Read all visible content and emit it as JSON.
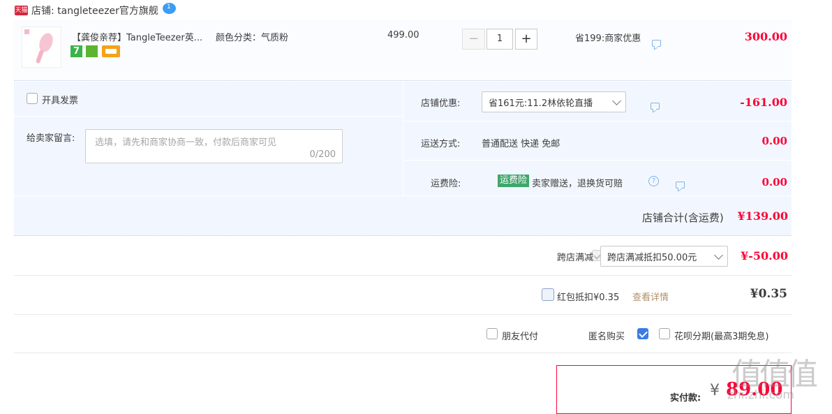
{
  "shop": {
    "badge": "天猫",
    "name": "店铺: tangleteezer官方旗舰",
    "wangwang_badge": "1"
  },
  "item": {
    "title": "【龚俊亲荐】TangleTeezer英...",
    "variant": "颜色分类：气质粉",
    "price": "499.00",
    "quantity": "1",
    "minus": "−",
    "plus": "+",
    "discount": "省199:商家优惠",
    "subtotal": "300.00",
    "badge_seven": "7",
    "image_icon": "pink-hairbrush"
  },
  "invoice": {
    "label": "开具发票"
  },
  "note": {
    "label": "给卖家留言:",
    "placeholder": "选填，请先和商家协商一致，付款后商家可见",
    "counter": "0/200"
  },
  "shop_discount": {
    "label": "店铺优惠:",
    "selected": "省161元:11.2林依轮直播",
    "amount": "-161.00"
  },
  "shipping": {
    "label": "运送方式:",
    "value": "普通配送 快递 免邮",
    "amount": "0.00"
  },
  "insurance": {
    "label": "运费险:",
    "tag": "运费险",
    "desc": "卖家赠送，退换货可赔",
    "amount": "0.00"
  },
  "shop_total": {
    "label": "店铺合计(含运费)",
    "amount": "¥139.00"
  },
  "cross_store": {
    "label": "跨店满减",
    "selected": "跨店满减抵扣50.00元",
    "amount": "¥-50.00"
  },
  "red_packet": {
    "label": "红包抵扣¥0.35",
    "link": "查看详情",
    "amount": "¥0.35"
  },
  "options": {
    "friend_pay": "朋友代付",
    "anonymous": "匿名购买",
    "huabei": "花呗分期(最高3期免息)"
  },
  "payment": {
    "label": "实付款:",
    "currency": "¥",
    "amount": "89.00"
  },
  "watermark": {
    "text": "值值值",
    "sub": "zhi.zhi.com"
  },
  "colors": {
    "price_red": "#ff0036",
    "panel_blue": "#f2f7ff",
    "tag_green": "#3fa76b",
    "link_brown": "#b0916a"
  }
}
